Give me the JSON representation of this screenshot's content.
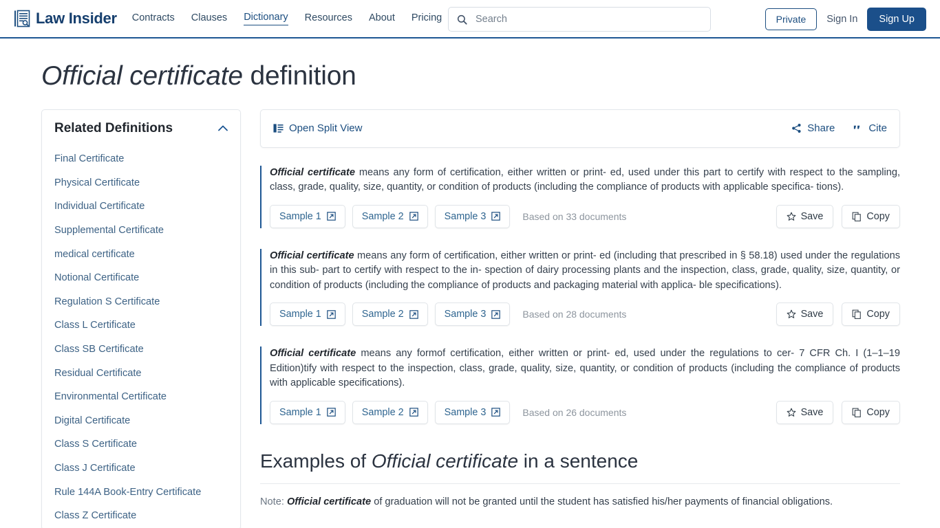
{
  "header": {
    "brand_name": "Law Insider",
    "brand_icon": "document-search-icon",
    "nav": [
      {
        "label": "Contracts",
        "active": false
      },
      {
        "label": "Clauses",
        "active": false
      },
      {
        "label": "Dictionary",
        "active": true
      },
      {
        "label": "Resources",
        "active": false
      },
      {
        "label": "About",
        "active": false
      },
      {
        "label": "Pricing",
        "active": false
      }
    ],
    "search": {
      "placeholder": "Search",
      "value": "",
      "icon": "search-icon"
    },
    "private_label": "Private",
    "signin_label": "Sign In",
    "signup_label": "Sign Up",
    "accent_color": "#1b4f8a",
    "border_color": "#1c5693"
  },
  "page": {
    "title_term": "Official certificate",
    "title_suffix": " definition"
  },
  "sidebar": {
    "title": "Related Definitions",
    "collapse_icon": "chevron-up-icon",
    "items": [
      {
        "label": "Final Certificate"
      },
      {
        "label": "Physical Certificate"
      },
      {
        "label": "Individual Certificate"
      },
      {
        "label": "Supplemental Certificate"
      },
      {
        "label": "medical certificate"
      },
      {
        "label": "Notional Certificate"
      },
      {
        "label": "Regulation S Certificate"
      },
      {
        "label": "Class L Certificate"
      },
      {
        "label": "Class SB Certificate"
      },
      {
        "label": "Residual Certificate"
      },
      {
        "label": "Environmental Certificate"
      },
      {
        "label": "Digital Certificate"
      },
      {
        "label": "Class S Certificate"
      },
      {
        "label": "Class J Certificate"
      },
      {
        "label": "Rule 144A Book-Entry Certificate"
      },
      {
        "label": "Class Z Certificate"
      }
    ]
  },
  "toolbar": {
    "split_view_label": "Open Split View",
    "split_view_icon": "split-view-icon",
    "share_label": "Share",
    "share_icon": "share-icon",
    "cite_label": "Cite",
    "cite_icon": "quote-icon"
  },
  "definitions": [
    {
      "term": "Official certificate",
      "text": " means any form of certification, either written or print- ed, used under this part to certify with respect to the sampling, class, grade, quality, size, quantity, or condition of products (including the compliance of products with applicable specifica- tions).",
      "samples": [
        "Sample 1",
        "Sample 2",
        "Sample 3"
      ],
      "based_on": "Based on 33 documents",
      "save_label": "Save",
      "copy_label": "Copy"
    },
    {
      "term": "Official certificate",
      "text": " means any form of certification, either written or print- ed (including that prescribed in § 58.18) used under the regulations in this sub- part to certify with respect to the in- spection of dairy processing plants and the inspection, class, grade, quality, size, quantity, or condition of products (including the compliance of products and packaging material with applica- ble specifications).",
      "samples": [
        "Sample 1",
        "Sample 2",
        "Sample 3"
      ],
      "based_on": "Based on 28 documents",
      "save_label": "Save",
      "copy_label": "Copy"
    },
    {
      "term": "Official certificate",
      "text": " means any formof certification, either written or print- ed, used under the regulations to cer- 7 CFR Ch. I (1–1–19 Edition)tify with respect to the inspection, class, grade, quality, size, quantity, or condition of products (including the compliance of products with applicable specifications).",
      "samples": [
        "Sample 1",
        "Sample 2",
        "Sample 3"
      ],
      "based_on": "Based on 26 documents",
      "save_label": "Save",
      "copy_label": "Copy"
    }
  ],
  "examples": {
    "heading_prefix": "Examples of ",
    "heading_term": "Official certificate",
    "heading_suffix": " in a sentence",
    "note_label": "Note: ",
    "note_term": "Official certificate",
    "note_text": " of graduation will not be granted until the student has satisfied his/her payments of financial obligations."
  }
}
